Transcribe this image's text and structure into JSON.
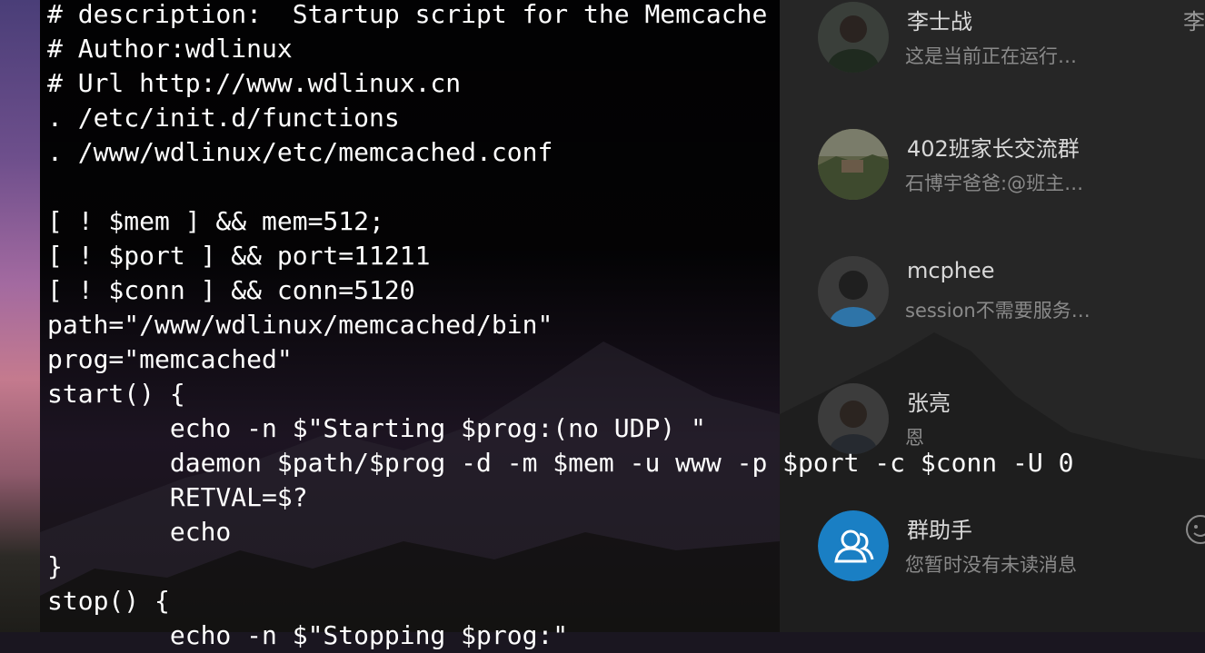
{
  "terminal": {
    "lines": [
      "# description:  Startup script for the Memcache",
      "# Author:wdlinux",
      "# Url http://www.wdlinux.cn",
      ". /etc/init.d/functions",
      ". /www/wdlinux/etc/memcached.conf",
      "",
      "[ ! $mem ] && mem=512;",
      "[ ! $port ] && port=11211",
      "[ ! $conn ] && conn=5120",
      "path=\"/www/wdlinux/memcached/bin\"",
      "prog=\"memcached\"",
      "start() {",
      "        echo -n $\"Starting $prog:(no UDP) \"",
      "        daemon $path/$prog -d -m $mem -u www -p $port -c $conn -U 0",
      "        RETVAL=$?",
      "        echo",
      "}",
      "stop() {",
      "        echo -n $\"Stopping $prog:\""
    ]
  },
  "chat": {
    "edge_text": "李",
    "items": [
      {
        "name": "李士战",
        "preview": "这是当前正在运行…",
        "avatar_icon": "person-photo-icon"
      },
      {
        "name": "402班家长交流群",
        "preview": "石博宇爸爸:@班主…",
        "avatar_icon": "landscape-photo-icon"
      },
      {
        "name": "mcphee",
        "preview": "session不需要服务…",
        "avatar_icon": "default-person-icon"
      },
      {
        "name": "张亮",
        "preview": "恩",
        "avatar_icon": "person-photo-icon"
      },
      {
        "name": "群助手",
        "preview": "您暂时没有未读消息",
        "avatar_icon": "group-assistant-icon"
      }
    ]
  },
  "colors": {
    "terminal_text": "#ffffff",
    "chat_name": "#d8d8d8",
    "chat_preview": "#8a8a8a",
    "group_assistant_blue": "#1a7fc4"
  }
}
